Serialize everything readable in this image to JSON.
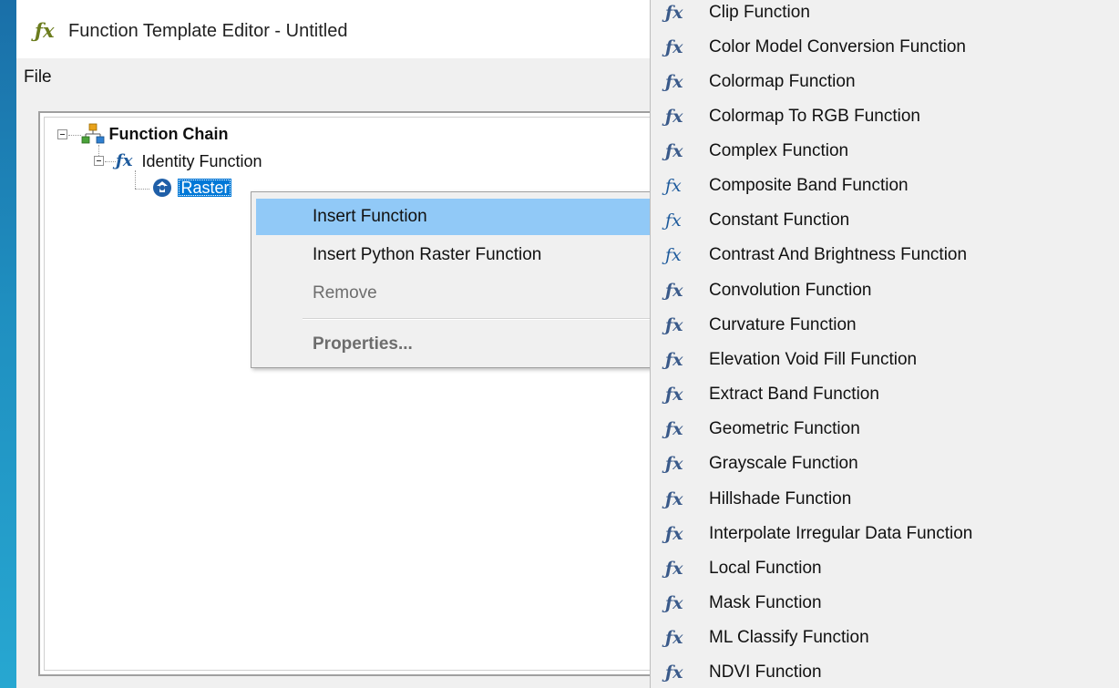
{
  "window": {
    "title": "Function Template Editor - Untitled",
    "menu_file": "File"
  },
  "tree": {
    "root": {
      "label": "Function Chain",
      "icon": "function-chain-icon"
    },
    "identity": {
      "label": "Identity Function",
      "icon": "fx-icon"
    },
    "raster": {
      "label": "Raster",
      "icon": "raster-icon",
      "selected": true
    }
  },
  "context_menu": {
    "items": [
      {
        "label": "Insert Function",
        "highlighted": true,
        "has_submenu": true,
        "arrow": ">"
      },
      {
        "label": "Insert Python Raster Function"
      },
      {
        "label": "Remove",
        "disabled": true
      },
      {
        "label": "Properties...",
        "disabled": true,
        "bold": true
      }
    ]
  },
  "submenu": {
    "items": [
      {
        "label": "Clip Function",
        "icon": "fx-stack-icon"
      },
      {
        "label": "Color Model Conversion Function",
        "icon": "fx-stack-icon"
      },
      {
        "label": "Colormap Function",
        "icon": "fx-stack-icon"
      },
      {
        "label": "Colormap To RGB Function",
        "icon": "fx-stack-icon"
      },
      {
        "label": "Complex Function",
        "icon": "fx-stack-icon"
      },
      {
        "label": "Composite Band Function",
        "icon": "fx-icon"
      },
      {
        "label": "Constant Function",
        "icon": "fx-icon"
      },
      {
        "label": "Contrast And Brightness Function",
        "icon": "fx-icon"
      },
      {
        "label": "Convolution Function",
        "icon": "fx-stack-icon"
      },
      {
        "label": "Curvature Function",
        "icon": "fx-stack-icon"
      },
      {
        "label": "Elevation Void Fill Function",
        "icon": "fx-stack-icon"
      },
      {
        "label": "Extract Band Function",
        "icon": "fx-stack-icon"
      },
      {
        "label": "Geometric Function",
        "icon": "fx-stack-icon"
      },
      {
        "label": "Grayscale Function",
        "icon": "fx-stack-icon"
      },
      {
        "label": "Hillshade Function",
        "icon": "fx-stack-icon"
      },
      {
        "label": "Interpolate Irregular Data Function",
        "icon": "fx-stack-icon"
      },
      {
        "label": "Local Function",
        "icon": "fx-stack-icon"
      },
      {
        "label": "Mask Function",
        "icon": "fx-stack-icon"
      },
      {
        "label": "ML Classify Function",
        "icon": "fx-stack-icon"
      },
      {
        "label": "NDVI Function",
        "icon": "fx-stack-icon"
      }
    ]
  },
  "colors": {
    "menu_highlight": "#91c9f7",
    "selection": "#0078d7",
    "desktop": "#1f8fc0"
  }
}
